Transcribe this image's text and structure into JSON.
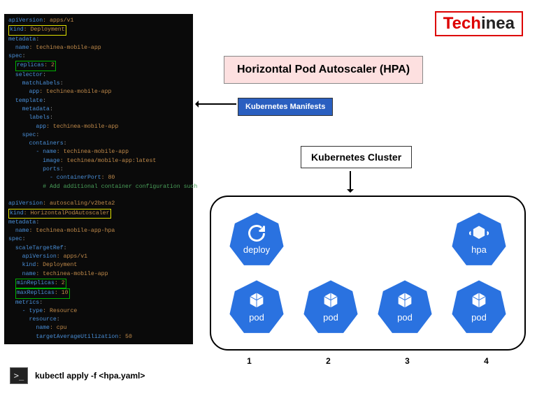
{
  "logo": {
    "part1": "Tech",
    "part2": "inea"
  },
  "title": "Horizontal Pod Autoscaler (HPA)",
  "labels": {
    "manifests": "Kubernetes Manifests",
    "cluster": "Kubernetes Cluster"
  },
  "yaml": {
    "deployment": {
      "l1a": "apiVersion",
      "l1b": ": apps/v1",
      "l2a": "kind",
      "l2b": ": Deployment",
      "l3a": "metadata",
      "l3b": ":",
      "l4a": "name",
      "l4b": ": techinea-mobile-app",
      "l5a": "spec",
      "l5b": ":",
      "l6a": "replicas",
      "l6b": ": 2",
      "l7a": "selector",
      "l7b": ":",
      "l8a": "matchLabels",
      "l8b": ":",
      "l9a": "app",
      "l9b": ": techinea-mobile-app",
      "l10a": "template",
      "l10b": ":",
      "l11a": "metadata",
      "l11b": ":",
      "l12a": "labels",
      "l12b": ":",
      "l13a": "app",
      "l13b": ": techinea-mobile-app",
      "l14a": "spec",
      "l14b": ":",
      "l15a": "containers",
      "l15b": ":",
      "l16a": "- name",
      "l16b": ": techinea-mobile-app",
      "l17a": "image",
      "l17b": ": techinea/mobile-app:latest",
      "l18a": "ports",
      "l18b": ":",
      "l19a": "- containerPort",
      "l19b": ": 80",
      "l20": "# Add additional container configuration such"
    },
    "hpa": {
      "l1a": "apiVersion",
      "l1b": ": autoscaling/v2beta2",
      "l2a": "kind",
      "l2b": ": HorizontalPodAutoscaler",
      "l3a": "metadata",
      "l3b": ":",
      "l4a": "name",
      "l4b": ": techinea-mobile-app-hpa",
      "l5a": "spec",
      "l5b": ":",
      "l6a": "scaleTargetRef",
      "l6b": ":",
      "l7a": "apiVersion",
      "l7b": ": apps/v1",
      "l8a": "kind",
      "l8b": ": Deployment",
      "l9a": "name",
      "l9b": ": techinea-mobile-app",
      "l10a": "minReplicas",
      "l10b": ": 2",
      "l11a": "maxReplicas",
      "l11b": ": 10",
      "l12a": "metrics",
      "l12b": ":",
      "l13a": "- type",
      "l13b": ": Resource",
      "l14a": "resource",
      "l14b": ":",
      "l15a": "name",
      "l15b": ": cpu",
      "l16a": "targetAverageUtilization",
      "l16b": ": 50"
    }
  },
  "nodes": {
    "deploy": "deploy",
    "hpa": "hpa",
    "pod": "pod"
  },
  "columns": [
    "1",
    "2",
    "3",
    "4"
  ],
  "terminal": {
    "prompt": ">_",
    "cmd": "kubectl apply -f <hpa.yaml>"
  }
}
